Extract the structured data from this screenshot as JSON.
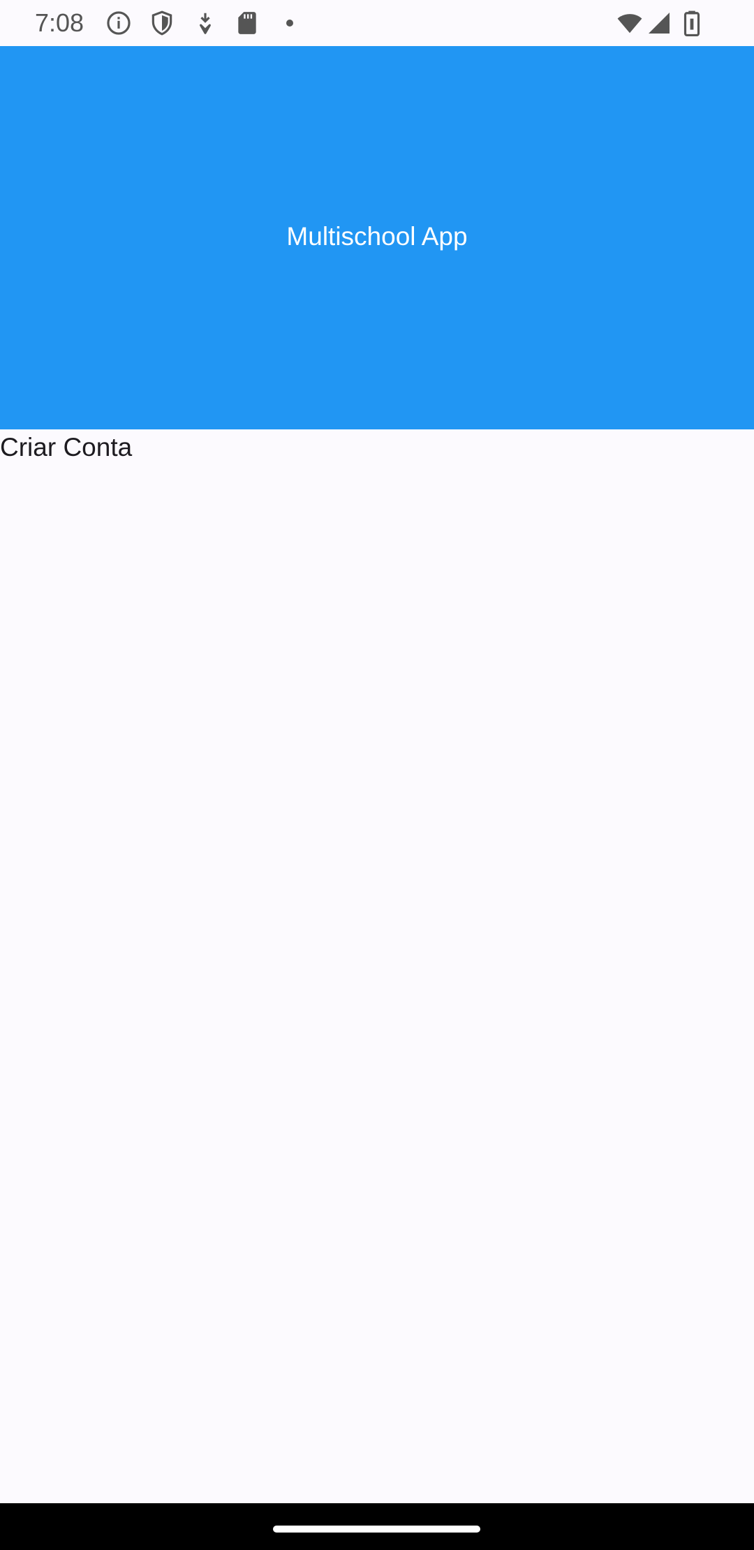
{
  "status_bar": {
    "time": "7:08",
    "left_icons": [
      "info-icon",
      "shield-icon",
      "download-icon",
      "sd-card-icon",
      "dot-icon"
    ],
    "right_icons": [
      "wifi-icon",
      "signal-icon",
      "battery-icon"
    ]
  },
  "header": {
    "title": "Multischool App",
    "background": "#2196f3"
  },
  "main": {
    "create_account_label": "Criar Conta"
  },
  "colors": {
    "page_background": "#fcfafe",
    "accent": "#2196f3",
    "text": "#1d1b20"
  }
}
